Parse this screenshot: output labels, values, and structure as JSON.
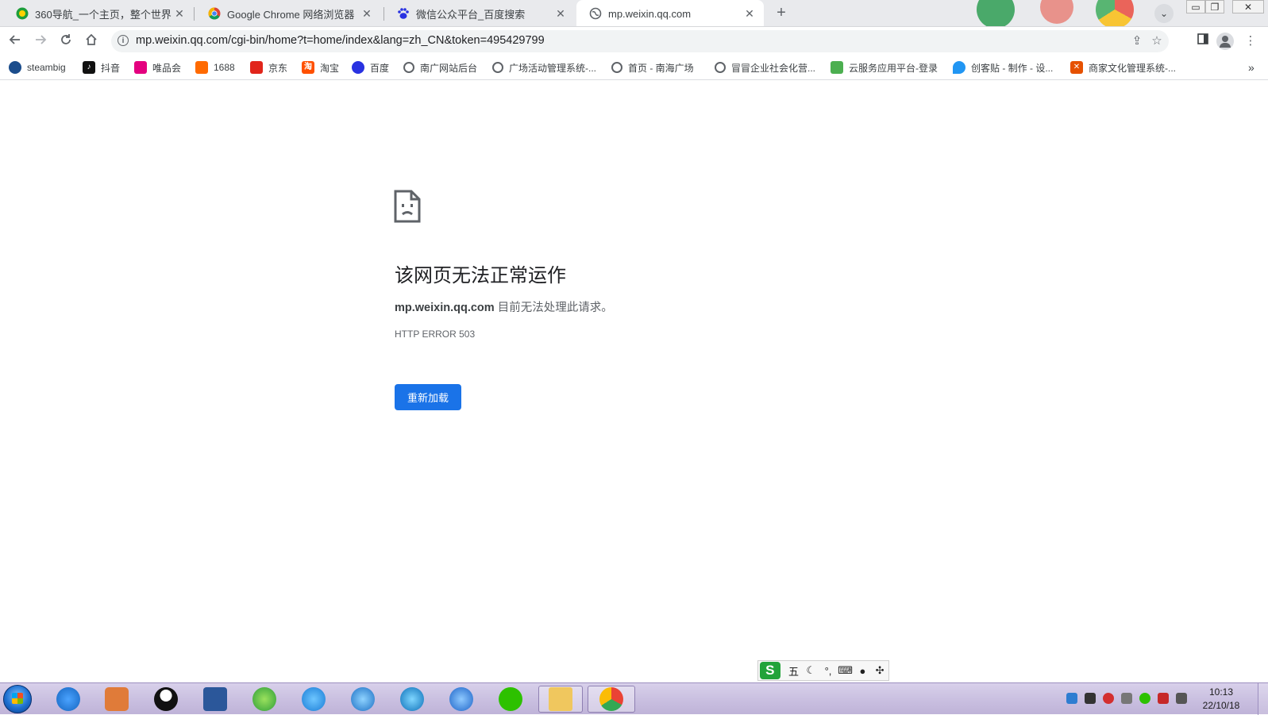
{
  "tabs": [
    {
      "title": "360导航_一个主页，整个世界",
      "icon": "360-nav-icon",
      "active": false
    },
    {
      "title": "Google Chrome 网络浏览器",
      "icon": "chrome-icon",
      "active": false
    },
    {
      "title": "微信公众平台_百度搜索",
      "icon": "baidu-paw-icon",
      "active": false
    },
    {
      "title": "mp.weixin.qq.com",
      "icon": "globe-icon",
      "active": true
    }
  ],
  "window_controls": {
    "minimize": "▭",
    "restore": "❐",
    "close": "✕"
  },
  "toolbar": {
    "url": "mp.weixin.qq.com/cgi-bin/home?t=home/index&lang=zh_CN&token=495429799"
  },
  "bookmarks": [
    {
      "label": "steambig",
      "color": "#1b4d8c"
    },
    {
      "label": "抖音",
      "color": "#111111"
    },
    {
      "label": "唯品会",
      "color": "#e4007f"
    },
    {
      "label": "1688",
      "color": "#ff6a00"
    },
    {
      "label": "京东",
      "color": "#e1251b"
    },
    {
      "label": "淘宝",
      "color": "#ff5000"
    },
    {
      "label": "百度",
      "color": "#2932e1"
    },
    {
      "label": "南广网站后台",
      "color": "globe"
    },
    {
      "label": "广场活动管理系统-...",
      "color": "globe"
    },
    {
      "label": "首页 - 南海广场",
      "color": "globe"
    },
    {
      "label": "冒冒企业社会化营...",
      "color": "globe"
    },
    {
      "label": "云服务应用平台-登录",
      "color": "#4caf50"
    },
    {
      "label": "创客贴 - 制作 - 设...",
      "color": "#2196f3"
    },
    {
      "label": "商家文化管理系统-...",
      "color": "#e65100"
    }
  ],
  "error": {
    "title": "该网页无法正常运作",
    "host": "mp.weixin.qq.com",
    "message": " 目前无法处理此请求。",
    "code": "HTTP ERROR 503",
    "reload_label": "重新加载"
  },
  "ime": {
    "mode": "五",
    "icons": [
      "moon-icon",
      "punctuation-icon",
      "keyboard-icon",
      "user-icon",
      "apps-icon"
    ]
  },
  "clock": {
    "time": "10:13",
    "date": "22/10/18"
  },
  "colors": {
    "accent": "#1a73e8",
    "tab_strip": "#e9eaed",
    "taskbar": "#c9bfe0"
  }
}
